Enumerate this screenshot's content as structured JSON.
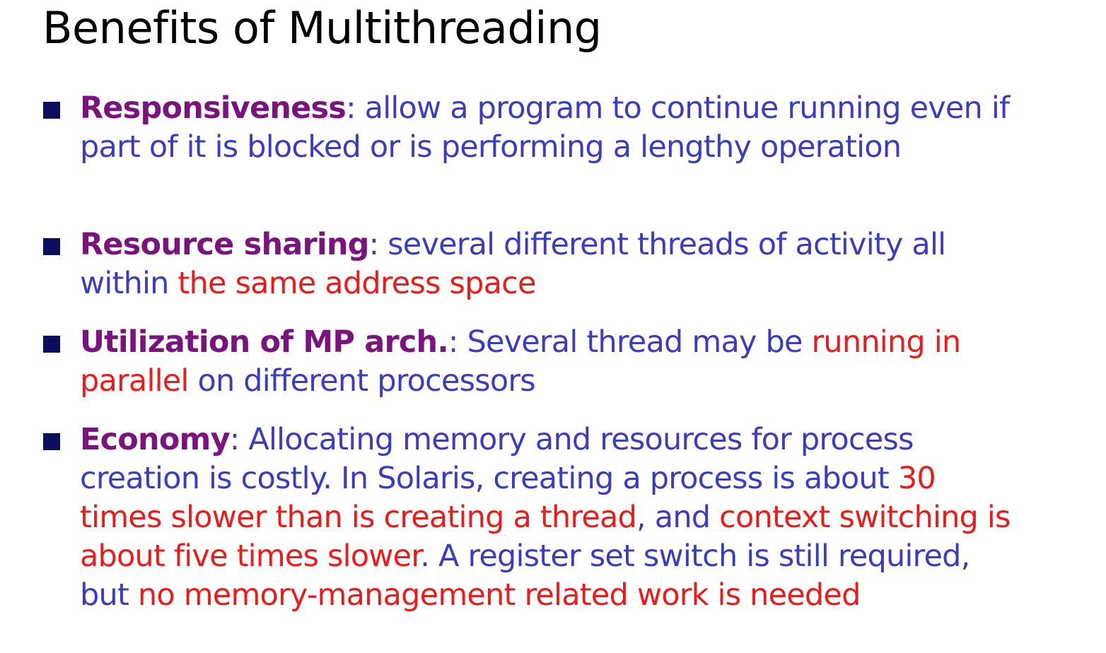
{
  "slide": {
    "title": "Benefits of Multithreading",
    "bullets": [
      {
        "term": "Responsiveness",
        "segments": [
          {
            "text": ": allow a program to continue running even if part of it is blocked or is performing a lengthy operation",
            "color": "blue"
          }
        ]
      },
      {
        "term": "Resource sharing",
        "segments": [
          {
            "text": ": several different threads of activity all within ",
            "color": "blue"
          },
          {
            "text": "the same address space",
            "color": "red"
          }
        ]
      },
      {
        "term": "Utilization of MP arch.",
        "segments": [
          {
            "text": ": Several thread may be ",
            "color": "blue"
          },
          {
            "text": "running in parallel",
            "color": "red"
          },
          {
            "text": " on different processors",
            "color": "blue"
          }
        ]
      },
      {
        "term": "Economy",
        "segments": [
          {
            "text": ": Allocating memory and resources for process creation is costly. In Solaris, creating a process is about ",
            "color": "blue"
          },
          {
            "text": "30 times slower than is creating a thread",
            "color": "red"
          },
          {
            "text": ", and ",
            "color": "blue"
          },
          {
            "text": "context switching is about five times slower",
            "color": "red"
          },
          {
            "text": ". A register set switch is still required, but ",
            "color": "blue"
          },
          {
            "text": "no memory-management related work is needed",
            "color": "red"
          }
        ]
      }
    ]
  },
  "colors": {
    "term": "#7a137e",
    "body": "#3c3cbe",
    "highlight": "#ec1b1b",
    "marker": "#0d0d5e",
    "title": "#000000"
  },
  "icons": {
    "bullet_marker": "square-bullet-icon"
  }
}
